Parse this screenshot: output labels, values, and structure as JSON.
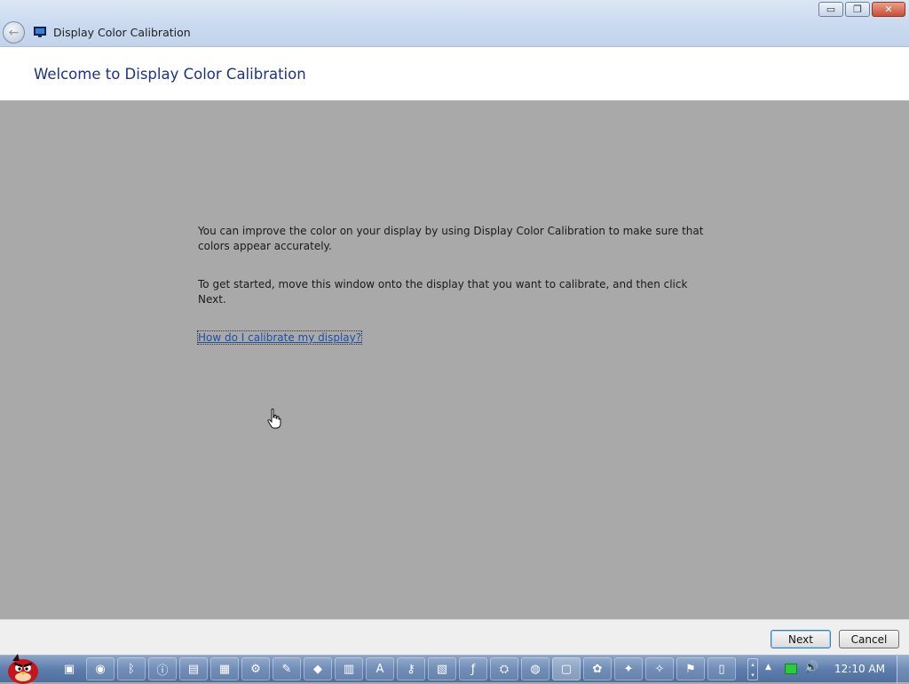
{
  "window": {
    "title": "Display Color Calibration",
    "minimize_glyph": "▭",
    "maximize_glyph": "❐",
    "close_glyph": "✕",
    "back_glyph": "←"
  },
  "page": {
    "heading": "Welcome to Display Color Calibration",
    "paragraph1": "You can improve the color on your display by using Display Color Calibration to make sure that colors appear accurately.",
    "paragraph2": "To get started, move this window onto the display that you want to calibrate, and then click Next.",
    "help_link": "How do I calibrate my display?"
  },
  "buttons": {
    "next": "Next",
    "cancel": "Cancel"
  },
  "taskbar": {
    "start_icon": "angry-bird-start-orb",
    "pinned": [
      {
        "name": "folder-icon",
        "glyph": "▣"
      },
      {
        "name": "chrome-icon",
        "glyph": "◉"
      },
      {
        "name": "bluetooth-icon",
        "glyph": "ᛒ"
      },
      {
        "name": "info-icon",
        "glyph": "ⓘ"
      },
      {
        "name": "app-icon-1",
        "glyph": "▤"
      },
      {
        "name": "app-icon-2",
        "glyph": "▦"
      },
      {
        "name": "app-icon-3",
        "glyph": "⚙"
      },
      {
        "name": "app-icon-4",
        "glyph": "✎"
      },
      {
        "name": "app-icon-5",
        "glyph": "◆"
      },
      {
        "name": "app-icon-6",
        "glyph": "▥"
      },
      {
        "name": "app-icon-7",
        "glyph": "A"
      },
      {
        "name": "key-icon",
        "glyph": "⚷"
      },
      {
        "name": "app-icon-8",
        "glyph": "▧"
      },
      {
        "name": "flash-icon",
        "glyph": "ƒ"
      },
      {
        "name": "network-app-icon",
        "glyph": "⛭"
      },
      {
        "name": "globe-icon",
        "glyph": "◍"
      },
      {
        "name": "display-calibration-icon",
        "glyph": "▢"
      },
      {
        "name": "app-icon-9",
        "glyph": "✿"
      },
      {
        "name": "app-icon-10",
        "glyph": "✦"
      },
      {
        "name": "app-icon-11",
        "glyph": "✧"
      },
      {
        "name": "app-icon-12",
        "glyph": "⚑"
      },
      {
        "name": "calculator-icon",
        "glyph": "▯"
      }
    ],
    "clock": "12:10 AM",
    "tray_up": "▴",
    "tray_down": "▾",
    "tray_arrow": "▲",
    "volume_glyph": "🔊"
  },
  "colors": {
    "title_blue": "#1e3287",
    "link_blue": "#1f4fa6",
    "content_gray": "#a9a9a9"
  }
}
